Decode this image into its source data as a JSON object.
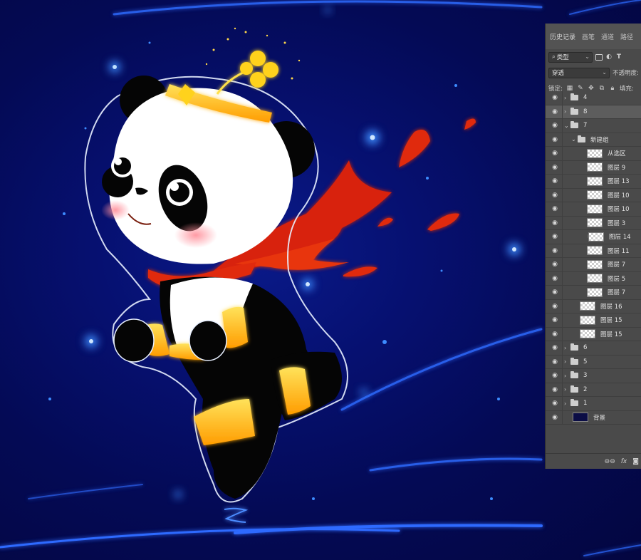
{
  "panel": {
    "tabs": [
      "历史记录",
      "画笔",
      "通道",
      "路径"
    ],
    "filter_label": "类型",
    "blend_mode": "穿透",
    "opacity_label": "不透明度:",
    "lock_label": "锁定:",
    "fill_label": "填充:"
  },
  "layers": [
    {
      "name": "4",
      "kind": "group",
      "depth": 0,
      "expanded": false,
      "selected": false
    },
    {
      "name": "8",
      "kind": "group",
      "depth": 0,
      "expanded": false,
      "selected": true
    },
    {
      "name": "7",
      "kind": "group",
      "depth": 0,
      "expanded": true,
      "selected": false
    },
    {
      "name": "新建组",
      "kind": "group",
      "depth": 1,
      "expanded": true,
      "selected": false
    },
    {
      "name": "从选区",
      "kind": "layer",
      "depth": 2,
      "selected": false
    },
    {
      "name": "图层 9",
      "kind": "layer",
      "depth": 2,
      "selected": false
    },
    {
      "name": "图层 13",
      "kind": "layer",
      "depth": 2,
      "selected": false
    },
    {
      "name": "图层 10",
      "kind": "layer",
      "depth": 2,
      "selected": false
    },
    {
      "name": "图层 10",
      "kind": "layer",
      "depth": 2,
      "selected": false
    },
    {
      "name": "图层 3",
      "kind": "layer",
      "depth": 2,
      "selected": false
    },
    {
      "name": "图层 14",
      "kind": "layer",
      "depth": 3,
      "clipped": true,
      "selected": false
    },
    {
      "name": "图层 11",
      "kind": "layer",
      "depth": 2,
      "selected": false
    },
    {
      "name": "图层 7",
      "kind": "layer",
      "depth": 2,
      "selected": false
    },
    {
      "name": "图层 5",
      "kind": "layer",
      "depth": 2,
      "selected": false
    },
    {
      "name": "图层 7",
      "kind": "layer",
      "depth": 2,
      "selected": false
    },
    {
      "name": "图层 16",
      "kind": "layer",
      "depth": 1,
      "selected": false
    },
    {
      "name": "图层 15",
      "kind": "layer",
      "depth": 1,
      "selected": false
    },
    {
      "name": "图层 15",
      "kind": "layer",
      "depth": 1,
      "selected": false
    },
    {
      "name": "6",
      "kind": "group",
      "depth": 0,
      "expanded": false,
      "selected": false
    },
    {
      "name": "5",
      "kind": "group",
      "depth": 0,
      "expanded": false,
      "selected": false
    },
    {
      "name": "3",
      "kind": "group",
      "depth": 0,
      "expanded": false,
      "selected": false
    },
    {
      "name": "2",
      "kind": "group",
      "depth": 0,
      "expanded": false,
      "selected": false
    },
    {
      "name": "1",
      "kind": "group",
      "depth": 0,
      "expanded": false,
      "selected": false
    },
    {
      "name": "背景",
      "kind": "background",
      "depth": 0,
      "selected": false
    }
  ],
  "footer_icons": [
    "link-icon",
    "fx-icon",
    "mask-icon"
  ],
  "colors": {
    "canvas_bg": "#06093a",
    "glow_yellow": "#ffd21a",
    "scarf_red": "#e0220a",
    "panel_bg": "#4a4a4a"
  }
}
